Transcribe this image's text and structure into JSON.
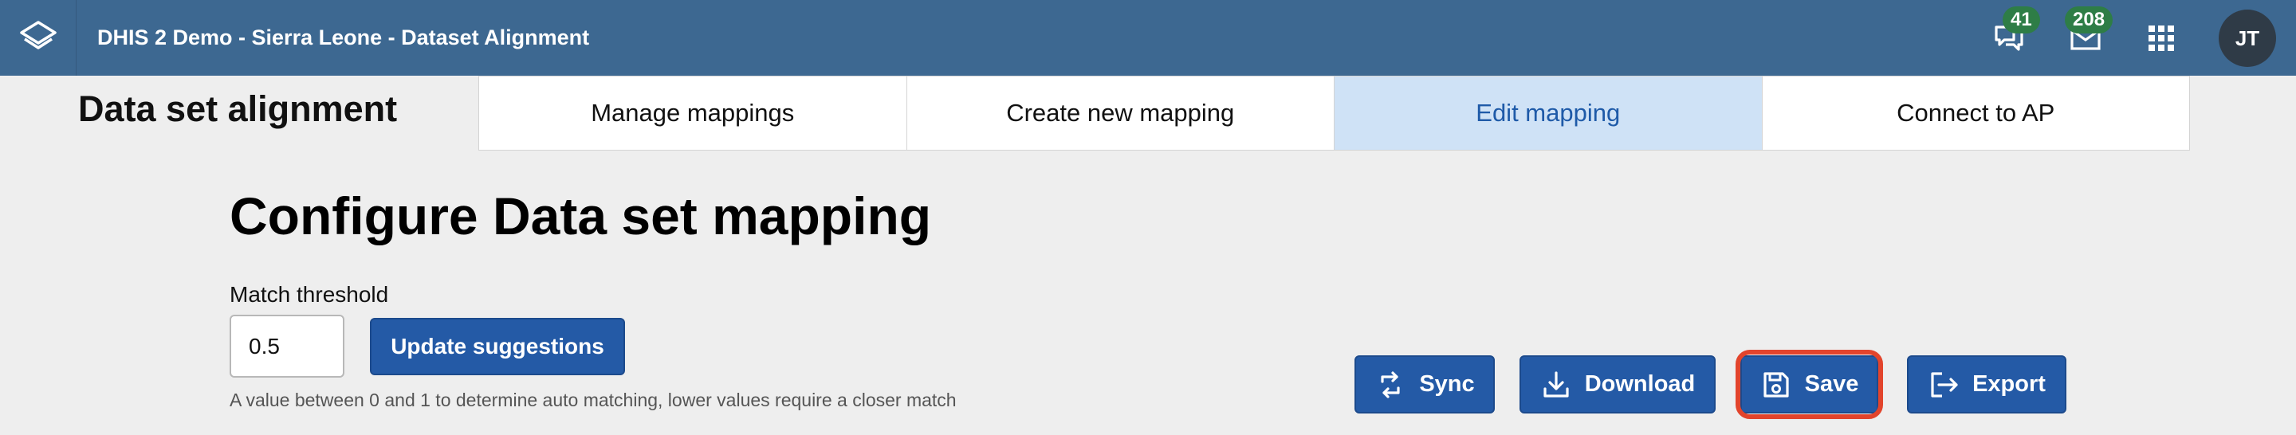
{
  "header": {
    "app_title": "DHIS 2 Demo - Sierra Leone - Dataset Alignment",
    "messages_count": "41",
    "inbox_count": "208",
    "user_initials": "JT",
    "bar_color": "#3d6891"
  },
  "app": {
    "heading": "Data set alignment",
    "tabs": [
      {
        "label": "Manage mappings",
        "active": false
      },
      {
        "label": "Create new mapping",
        "active": false
      },
      {
        "label": "Edit mapping",
        "active": true
      },
      {
        "label": "Connect to AP",
        "active": false
      }
    ]
  },
  "main": {
    "title": "Configure Data set mapping",
    "threshold_label": "Match threshold",
    "threshold_value": "0.5",
    "update_button": "Update suggestions",
    "helper_text": "A value between 0 and 1 to determine auto matching, lower values require a closer match"
  },
  "actions": {
    "sync": "Sync",
    "download": "Download",
    "save": "Save",
    "export": "Export",
    "button_color": "#245aa6",
    "highlight_color": "#e2442c"
  }
}
